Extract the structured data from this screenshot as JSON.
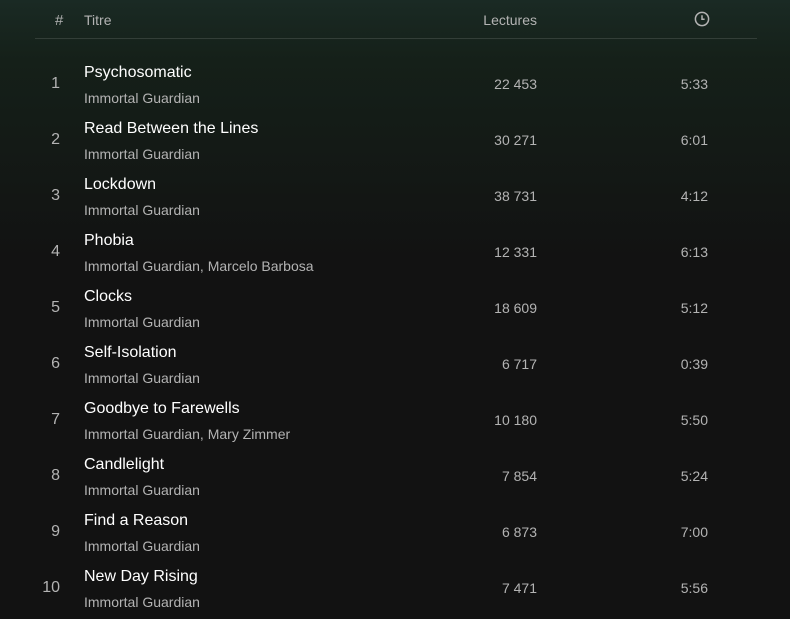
{
  "header": {
    "number_label": "#",
    "title_label": "Titre",
    "plays_label": "Lectures",
    "duration_icon": "clock-icon"
  },
  "tracks": [
    {
      "number": "1",
      "title": "Psychosomatic",
      "artists": "Immortal Guardian",
      "plays": "22 453",
      "duration": "5:33"
    },
    {
      "number": "2",
      "title": "Read Between the Lines",
      "artists": "Immortal Guardian",
      "plays": "30 271",
      "duration": "6:01"
    },
    {
      "number": "3",
      "title": "Lockdown",
      "artists": "Immortal Guardian",
      "plays": "38 731",
      "duration": "4:12"
    },
    {
      "number": "4",
      "title": "Phobia",
      "artists": "Immortal Guardian, Marcelo Barbosa",
      "plays": "12 331",
      "duration": "6:13"
    },
    {
      "number": "5",
      "title": "Clocks",
      "artists": "Immortal Guardian",
      "plays": "18 609",
      "duration": "5:12"
    },
    {
      "number": "6",
      "title": "Self-Isolation",
      "artists": "Immortal Guardian",
      "plays": "6 717",
      "duration": "0:39"
    },
    {
      "number": "7",
      "title": "Goodbye to Farewells",
      "artists": "Immortal Guardian, Mary Zimmer",
      "plays": "10 180",
      "duration": "5:50"
    },
    {
      "number": "8",
      "title": "Candlelight",
      "artists": "Immortal Guardian",
      "plays": "7 854",
      "duration": "5:24"
    },
    {
      "number": "9",
      "title": "Find a Reason",
      "artists": "Immortal Guardian",
      "plays": "6 873",
      "duration": "7:00"
    },
    {
      "number": "10",
      "title": "New Day Rising",
      "artists": "Immortal Guardian",
      "plays": "7 471",
      "duration": "5:56"
    }
  ]
}
